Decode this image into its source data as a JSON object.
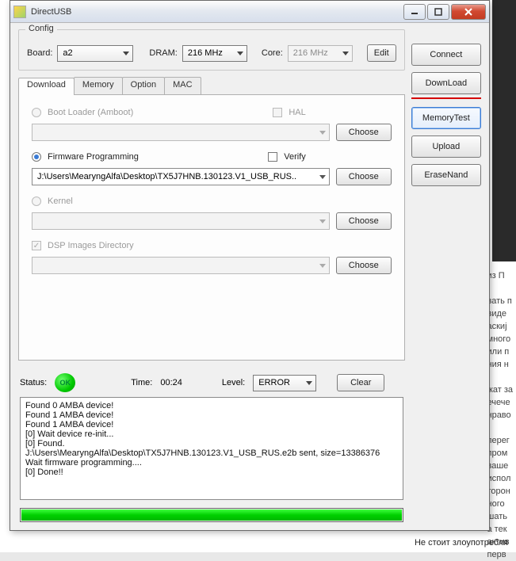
{
  "window": {
    "title": "DirectUSB"
  },
  "config": {
    "group_label": "Config",
    "board_label": "Board:",
    "board_value": "a2",
    "dram_label": "DRAM:",
    "dram_value": "216 MHz",
    "core_label": "Core:",
    "core_value": "216 MHz",
    "edit_label": "Edit"
  },
  "tabs": {
    "download": "Download",
    "memory": "Memory",
    "option": "Option",
    "mac": "MAC"
  },
  "download": {
    "bootloader_label": "Boot Loader (Amboot)",
    "hal_label": "HAL",
    "firmware_label": "Firmware Programming",
    "verify_label": "Verify",
    "firmware_path": "J:\\Users\\MearyngAlfa\\Desktop\\TX5J7HNB.130123.V1_USB_RUS..",
    "kernel_label": "Kernel",
    "dsp_label": "DSP Images Directory",
    "choose_label": "Choose"
  },
  "status": {
    "status_label": "Status:",
    "ok_text": "OK",
    "time_label": "Time:",
    "time_value": "00:24",
    "level_label": "Level:",
    "level_value": "ERROR",
    "clear_label": "Clear"
  },
  "log": "Found 0 AMBA device!\nFound 1 AMBA device!\nFound 1 AMBA device!\n[0] Wait device re-init...\n[0] Found.\nJ:\\Users\\MearyngAlfa\\Desktop\\TX5J7HNB.130123.V1_USB_RUS.e2b sent, size=13386376\nWait firmware programming....\n[0] Done!!",
  "side": {
    "connect": "Connect",
    "download": "DownLoad",
    "memorytest": "MemoryTest",
    "upload": "Upload",
    "erasenand": "EraseNand"
  },
  "bg_footer": "Не стоит злоупотребля"
}
